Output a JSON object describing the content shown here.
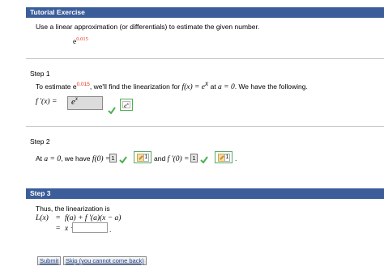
{
  "header": {
    "title": "Tutorial Exercise"
  },
  "problem": {
    "instruction": "Use a linear approximation (or differentials) to estimate the given number.",
    "expr_base": "e",
    "expr_exp": "0.015"
  },
  "step1": {
    "title": "Step 1",
    "text_a": "To estimate e",
    "text_exp": "0.015",
    "text_b": ", we'll find the linearization for ",
    "fx": "f(x) = e",
    "fx_exp": "x",
    "text_c": " at ",
    "a_eq": "a = 0",
    "text_d": ". We have the following.",
    "deriv_label": "f '(x) =",
    "answer_base": "e",
    "answer_exp": "x",
    "key_base": "e",
    "key_exp": "x"
  },
  "step2": {
    "title": "Step 2",
    "text_a": "At ",
    "a_eq": "a = 0",
    "text_b": ", we have ",
    "f0": "f(0) =",
    "f0_value": "1",
    "f0_key": "1",
    "text_and": "and ",
    "fp0": "f '(0) =",
    "fp0_value": "1",
    "fp0_key": "1",
    "end": "."
  },
  "step3": {
    "title": "Step 3",
    "text_a": "Thus, the linearization is",
    "line1_lhs": "L(x)",
    "line1_eq": "=",
    "line1_rhs": "f(a) + f '(a)(x − a)",
    "line2_eq": "=",
    "line2_rhs": "x +",
    "line2_value": "",
    "line2_end": "."
  },
  "buttons": {
    "submit": "Submit",
    "skip": "Skip (you cannot come back)"
  },
  "colors": {
    "header": "#3b5e9a",
    "highlight": "#e4321b",
    "correct": "#4caf50"
  }
}
